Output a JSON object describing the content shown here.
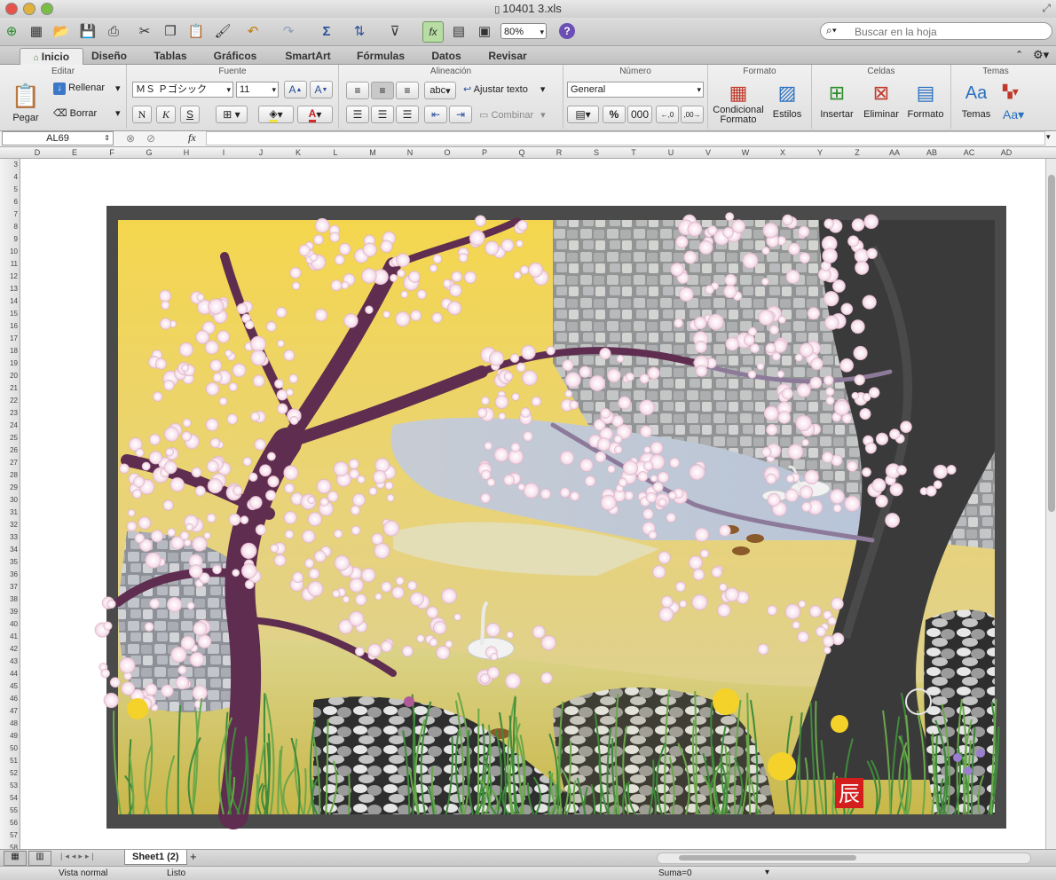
{
  "window": {
    "title": "10401 3.xls"
  },
  "toolbar": {
    "zoom": "80%",
    "search_placeholder": "Buscar en la hoja"
  },
  "tabs": [
    "Inicio",
    "Diseño",
    "Tablas",
    "Gráficos",
    "SmartArt",
    "Fórmulas",
    "Datos",
    "Revisar"
  ],
  "ribbon": {
    "groups": {
      "editar": "Editar",
      "fuente": "Fuente",
      "alineacion": "Alineación",
      "numero": "Número",
      "formato": "Formato",
      "celdas": "Celdas",
      "temas": "Temas"
    },
    "pegar": "Pegar",
    "rellenar": "Rellenar",
    "borrar": "Borrar",
    "font_name": "ＭＳ Ｐゴシック",
    "font_size": "11",
    "bold": "N",
    "italic": "K",
    "underline": "S",
    "wrap_text": "Ajustar texto",
    "abc": "abc",
    "combinar": "Combinar",
    "number_format": "General",
    "percent": "%",
    "thousands": "000",
    "cond_format_1": "Condicional",
    "cond_format_2": "Formato",
    "estilos": "Estilos",
    "insertar": "Insertar",
    "eliminar": "Eliminar",
    "formato_btn": "Formato",
    "temas_btn": "Temas",
    "aa": "Aa"
  },
  "formula_bar": {
    "name_box": "AL69",
    "fx": "fx",
    "content": ""
  },
  "columns": [
    "D",
    "E",
    "F",
    "G",
    "H",
    "I",
    "J",
    "K",
    "L",
    "M",
    "N",
    "O",
    "P",
    "Q",
    "R",
    "S",
    "T",
    "U",
    "V",
    "W",
    "X",
    "Y",
    "Z",
    "AA",
    "AB",
    "AC",
    "AD"
  ],
  "rows": [
    "3",
    "4",
    "5",
    "6",
    "7",
    "8",
    "9",
    "10",
    "11",
    "12",
    "13",
    "14",
    "15",
    "16",
    "17",
    "18",
    "19",
    "20",
    "21",
    "22",
    "23",
    "24",
    "25",
    "26",
    "27",
    "28",
    "29",
    "30",
    "31",
    "32",
    "33",
    "34",
    "35",
    "36",
    "37",
    "38",
    "39",
    "40",
    "41",
    "42",
    "43",
    "44",
    "45",
    "46",
    "47",
    "48",
    "49",
    "50",
    "51",
    "52",
    "53",
    "54",
    "55",
    "56",
    "57",
    "58"
  ],
  "sheet_tabs": [
    {
      "label": "Sheet1 (2)"
    }
  ],
  "status": {
    "view": "Vista normal",
    "ready": "Listo",
    "sum": "Suma=0"
  },
  "artwork": {
    "seal_char": "辰"
  },
  "colors": {
    "ribbon_accent": "#8cc98a",
    "sky": "#f0d562",
    "stone": "#a8abb2",
    "blossom": "#f7e6ef",
    "trunk": "#5a2b4a"
  }
}
